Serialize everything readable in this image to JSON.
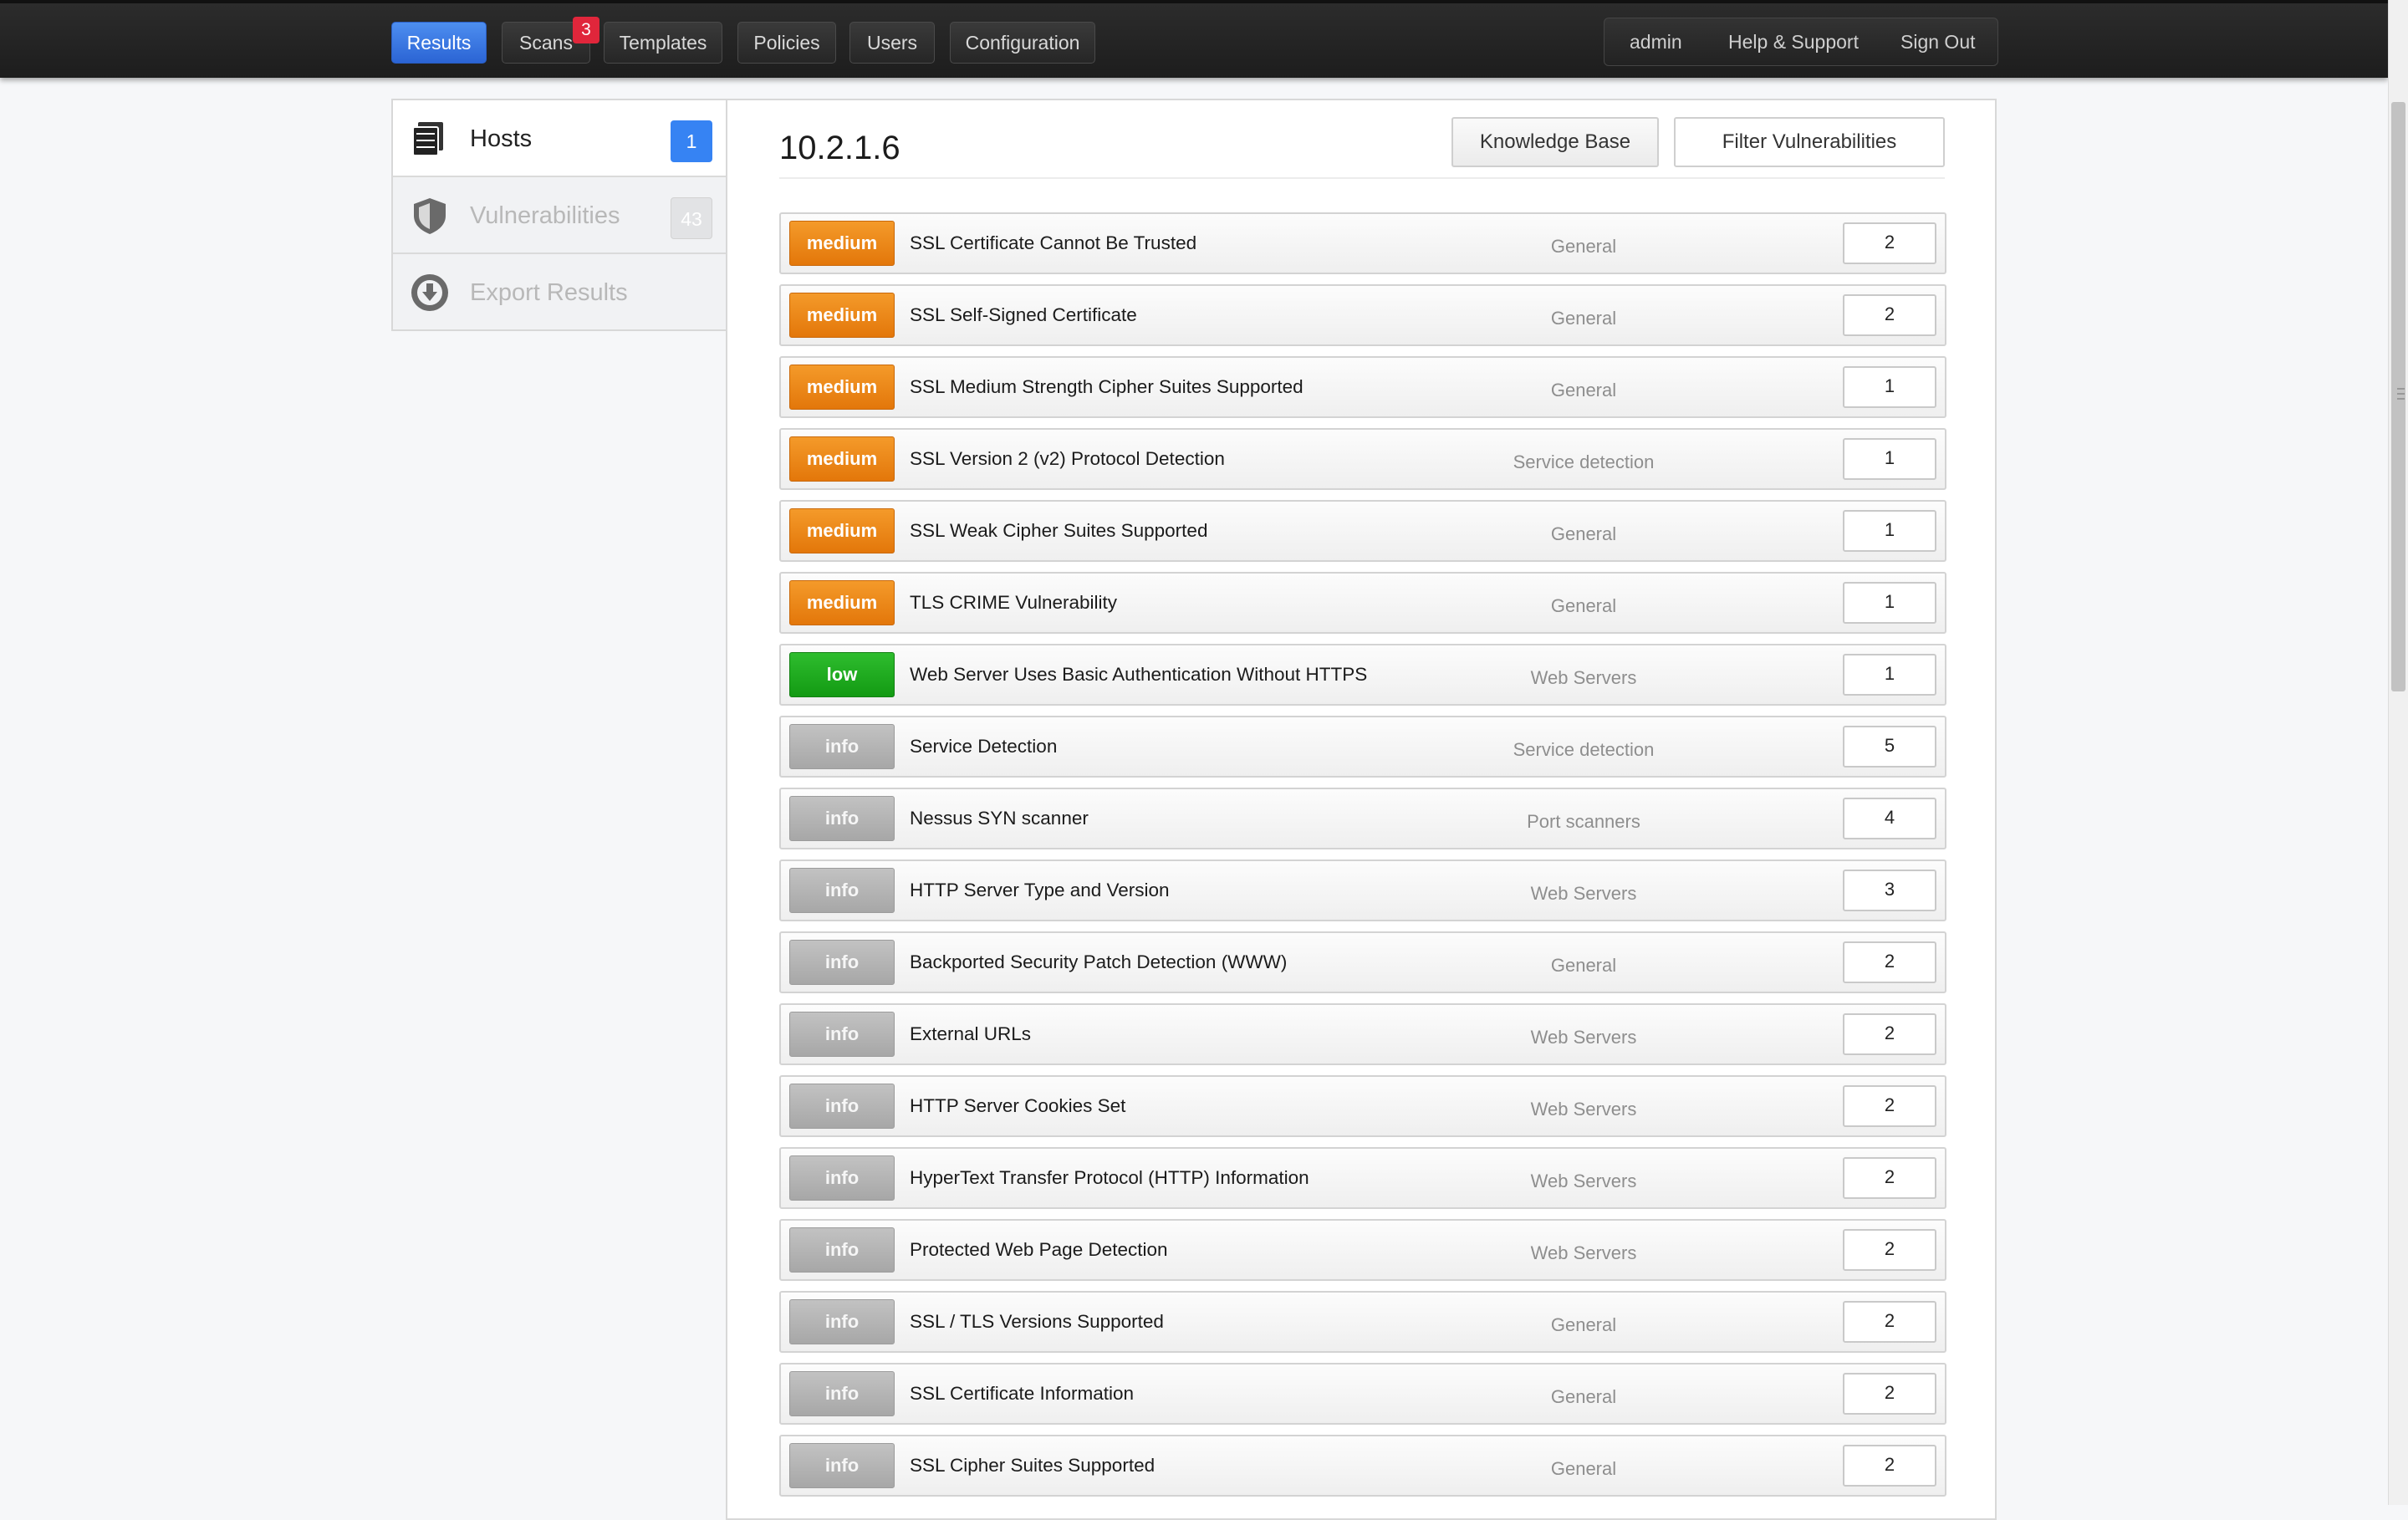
{
  "nav": {
    "tabs": [
      {
        "label": "Results"
      },
      {
        "label": "Scans",
        "badge": "3"
      },
      {
        "label": "Templates"
      },
      {
        "label": "Policies"
      },
      {
        "label": "Users"
      },
      {
        "label": "Configuration"
      }
    ],
    "active_tab": "Results",
    "user": {
      "name": "admin",
      "help": "Help & Support",
      "signout": "Sign Out"
    }
  },
  "sidebar": {
    "items": [
      {
        "label": "Hosts",
        "count": "1",
        "icon": "server-stack-icon",
        "active": true
      },
      {
        "label": "Vulnerabilities",
        "count": "43",
        "icon": "shield-icon",
        "active": false
      },
      {
        "label": "Export Results",
        "icon": "download-circle-icon",
        "active": false
      }
    ]
  },
  "main": {
    "title": "10.2.1.6",
    "knowledge_base_label": "Knowledge Base",
    "filter_label": "Filter Vulnerabilities"
  },
  "vulnerabilities": [
    {
      "severity": "medium",
      "name": "SSL Certificate Cannot Be Trusted",
      "family": "General",
      "count": "2"
    },
    {
      "severity": "medium",
      "name": "SSL Self-Signed Certificate",
      "family": "General",
      "count": "2"
    },
    {
      "severity": "medium",
      "name": "SSL Medium Strength Cipher Suites Supported",
      "family": "General",
      "count": "1"
    },
    {
      "severity": "medium",
      "name": "SSL Version 2 (v2) Protocol Detection",
      "family": "Service detection",
      "count": "1"
    },
    {
      "severity": "medium",
      "name": "SSL Weak Cipher Suites Supported",
      "family": "General",
      "count": "1"
    },
    {
      "severity": "medium",
      "name": "TLS CRIME Vulnerability",
      "family": "General",
      "count": "1"
    },
    {
      "severity": "low",
      "name": "Web Server Uses Basic Authentication Without HTTPS",
      "family": "Web Servers",
      "count": "1"
    },
    {
      "severity": "info",
      "name": "Service Detection",
      "family": "Service detection",
      "count": "5"
    },
    {
      "severity": "info",
      "name": "Nessus SYN scanner",
      "family": "Port scanners",
      "count": "4"
    },
    {
      "severity": "info",
      "name": "HTTP Server Type and Version",
      "family": "Web Servers",
      "count": "3"
    },
    {
      "severity": "info",
      "name": "Backported Security Patch Detection (WWW)",
      "family": "General",
      "count": "2"
    },
    {
      "severity": "info",
      "name": "External URLs",
      "family": "Web Servers",
      "count": "2"
    },
    {
      "severity": "info",
      "name": "HTTP Server Cookies Set",
      "family": "Web Servers",
      "count": "2"
    },
    {
      "severity": "info",
      "name": "HyperText Transfer Protocol (HTTP) Information",
      "family": "Web Servers",
      "count": "2"
    },
    {
      "severity": "info",
      "name": "Protected Web Page Detection",
      "family": "Web Servers",
      "count": "2"
    },
    {
      "severity": "info",
      "name": "SSL / TLS Versions Supported",
      "family": "General",
      "count": "2"
    },
    {
      "severity": "info",
      "name": "SSL Certificate Information",
      "family": "General",
      "count": "2"
    },
    {
      "severity": "info",
      "name": "SSL Cipher Suites Supported",
      "family": "General",
      "count": "2"
    }
  ],
  "colors": {
    "medium": "#e8840f",
    "low": "#1aa81a",
    "info": "#b4b4b4",
    "active_tab": "#3a78e4",
    "scan_badge": "#e0263b",
    "hosts_count": "#3683f3"
  }
}
